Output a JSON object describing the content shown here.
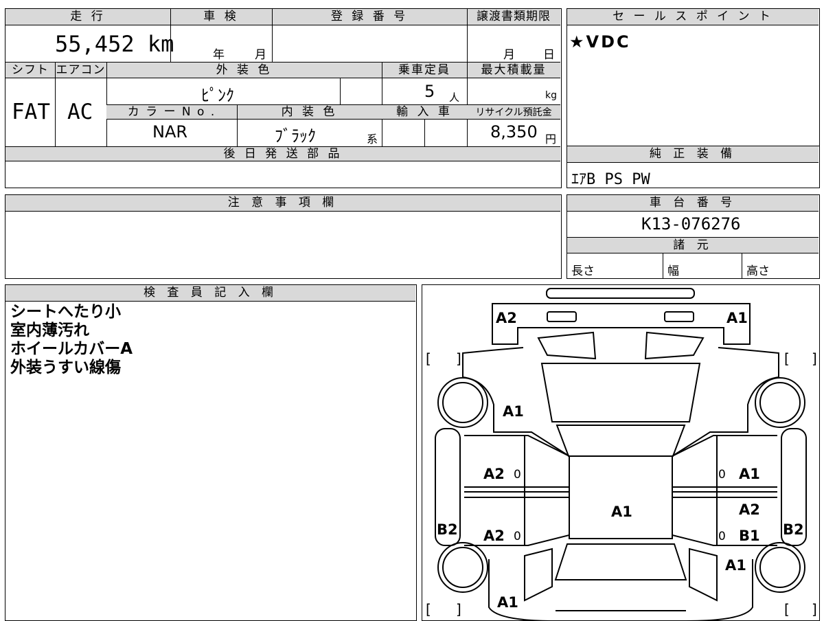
{
  "top_section": {
    "mileage": {
      "label": "走 行",
      "value": "55,452 km"
    },
    "inspection": {
      "label": "車 検",
      "year": "年",
      "month": "月"
    },
    "registration": {
      "label": "登 録 番 号",
      "value": ""
    },
    "transfer": {
      "label": "譲渡書類期限",
      "month": "月",
      "day": "日"
    },
    "shift": {
      "label": "シフト",
      "value": "FAT"
    },
    "aircon": {
      "label": "エアコン",
      "value": "AC"
    },
    "exterior_color": {
      "label": "外 装 色",
      "value": "ﾋﾟﾝｸ"
    },
    "capacity": {
      "label": "乗車定員",
      "value": "5",
      "unit": "人"
    },
    "max_load": {
      "label": "最大積載量",
      "unit": "kg"
    },
    "color_no": {
      "label": "カ ラ ー N o .",
      "value": "NAR"
    },
    "interior_color": {
      "label": "内 装 色",
      "value": "ﾌﾞﾗｯｸ",
      "suffix": "系"
    },
    "import": {
      "label": "輸 入 車"
    },
    "recycle": {
      "label": "リサイクル預託金",
      "value": "8,350",
      "unit": "円"
    },
    "later_parts": {
      "label": "後 日 発 送 部 品",
      "value": ""
    }
  },
  "sales_point": {
    "label": "セ ー ル ス ポ イ ン ト",
    "value": "★VDC"
  },
  "genuine_equipment": {
    "label": "純 正 装 備",
    "value": "ｴｱB PS PW"
  },
  "notes": {
    "label": "注 意 事 項 欄",
    "value": ""
  },
  "chassis": {
    "label": "車 台 番 号",
    "value": "K13-076276"
  },
  "specs": {
    "label": "諸 元",
    "length": "長さ",
    "width": "幅",
    "height": "高さ"
  },
  "inspector": {
    "label": "検 査 員 記 入 欄",
    "lines": [
      "シートへたり小",
      "室内薄汚れ",
      "ホイールカバーA",
      "外装うすい線傷"
    ]
  },
  "diagram": {
    "marks": {
      "front_left": "A2",
      "front_right": "A1",
      "left_front_fender": "A1",
      "left_front_door": "A2",
      "left_front_door_count": "0",
      "left_rear_door": "A2",
      "left_rear_door_count": "0",
      "left_rocker": "B2",
      "roof": "A1",
      "right_front_door": "A1",
      "right_front_door_count": "0",
      "right_rear_door_top": "A2",
      "right_rear_door": "B1",
      "right_rear_door_count": "0",
      "right_rocker": "B2",
      "right_rear_fender": "A1",
      "rear": "A1"
    },
    "brackets": {
      "open": "[",
      "close": "]"
    }
  }
}
